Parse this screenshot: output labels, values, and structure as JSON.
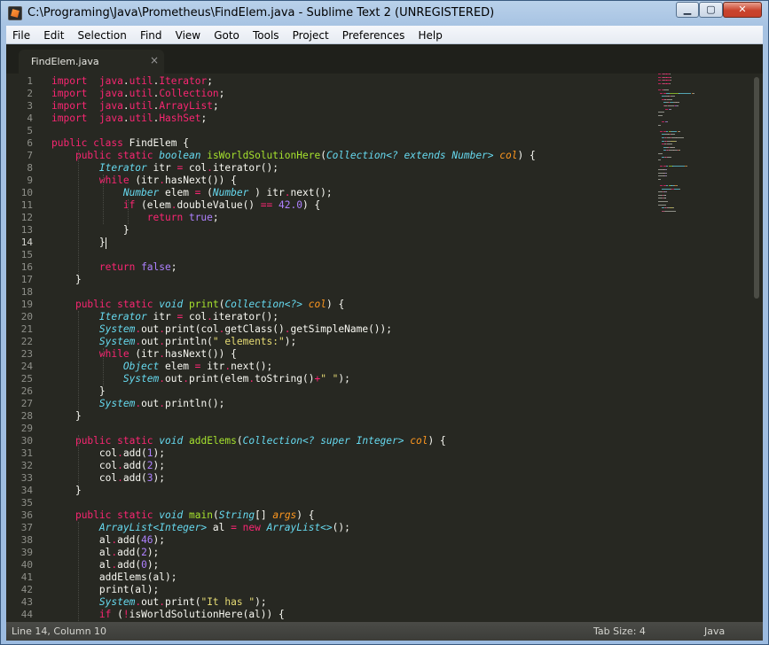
{
  "window": {
    "title": "C:\\Programing\\Java\\Prometheus\\FindElem.java - Sublime Text 2 (UNREGISTERED)",
    "buttons": {
      "minimize": "▁",
      "maximize": "▢",
      "close": "✕"
    }
  },
  "menu": [
    "File",
    "Edit",
    "Selection",
    "Find",
    "View",
    "Goto",
    "Tools",
    "Project",
    "Preferences",
    "Help"
  ],
  "tab": {
    "label": "FindElem.java",
    "close": "×"
  },
  "code": {
    "line_numbers": [
      "1",
      "2",
      "3",
      "4",
      "5",
      "6",
      "7",
      "8",
      "9",
      "10",
      "11",
      "12",
      "13",
      "14",
      "15",
      "16",
      "17",
      "18",
      "19",
      "20",
      "21",
      "22",
      "23",
      "24",
      "25",
      "26",
      "27",
      "28",
      "29",
      "30",
      "31",
      "32",
      "33",
      "34",
      "35",
      "36",
      "37",
      "38",
      "39",
      "40",
      "41",
      "42",
      "43",
      "44"
    ],
    "lines": [
      [
        [
          "k",
          "import"
        ],
        [
          "",
          "  "
        ],
        [
          "t2",
          "java"
        ],
        [
          "",
          "."
        ],
        [
          "t2",
          "util"
        ],
        [
          "",
          "."
        ],
        [
          "t2",
          "Iterator"
        ],
        [
          "",
          ";"
        ]
      ],
      [
        [
          "k",
          "import"
        ],
        [
          "",
          "  "
        ],
        [
          "t2",
          "java"
        ],
        [
          "",
          "."
        ],
        [
          "t2",
          "util"
        ],
        [
          "",
          "."
        ],
        [
          "t2",
          "Collection"
        ],
        [
          "",
          ";"
        ]
      ],
      [
        [
          "k",
          "import"
        ],
        [
          "",
          "  "
        ],
        [
          "t2",
          "java"
        ],
        [
          "",
          "."
        ],
        [
          "t2",
          "util"
        ],
        [
          "",
          "."
        ],
        [
          "t2",
          "ArrayList"
        ],
        [
          "",
          ";"
        ]
      ],
      [
        [
          "k",
          "import"
        ],
        [
          "",
          "  "
        ],
        [
          "t2",
          "java"
        ],
        [
          "",
          "."
        ],
        [
          "t2",
          "util"
        ],
        [
          "",
          "."
        ],
        [
          "t2",
          "HashSet"
        ],
        [
          "",
          ";"
        ]
      ],
      [],
      [
        [
          "k",
          "public"
        ],
        [
          "",
          " "
        ],
        [
          "k",
          "class"
        ],
        [
          "",
          " FindElem {"
        ]
      ],
      [
        [
          "",
          "    "
        ],
        [
          "k",
          "public"
        ],
        [
          "",
          " "
        ],
        [
          "k",
          "static"
        ],
        [
          "",
          " "
        ],
        [
          "t",
          "boolean"
        ],
        [
          "",
          " "
        ],
        [
          "f",
          "isWorldSolutionHere"
        ],
        [
          "",
          "("
        ],
        [
          "t",
          "Collection<? extends Number>"
        ],
        [
          "",
          " "
        ],
        [
          "p",
          "col"
        ],
        [
          "",
          ") {"
        ]
      ],
      [
        [
          "",
          "        "
        ],
        [
          "t",
          "Iterator"
        ],
        [
          "",
          " itr "
        ],
        [
          "k",
          "="
        ],
        [
          "",
          " col"
        ],
        [
          "k",
          "."
        ],
        [
          "",
          "iterator();"
        ]
      ],
      [
        [
          "",
          "        "
        ],
        [
          "k",
          "while"
        ],
        [
          "",
          " (itr"
        ],
        [
          "k",
          "."
        ],
        [
          "",
          "hasNext()) {"
        ]
      ],
      [
        [
          "",
          "            "
        ],
        [
          "t",
          "Number"
        ],
        [
          "",
          " elem "
        ],
        [
          "k",
          "="
        ],
        [
          "",
          " ("
        ],
        [
          "t",
          "Number"
        ],
        [
          "",
          " ) itr"
        ],
        [
          "k",
          "."
        ],
        [
          "",
          "next();"
        ]
      ],
      [
        [
          "",
          "            "
        ],
        [
          "k",
          "if"
        ],
        [
          "",
          " (elem"
        ],
        [
          "k",
          "."
        ],
        [
          "",
          "doubleValue() "
        ],
        [
          "k",
          "=="
        ],
        [
          "",
          " "
        ],
        [
          "n",
          "42.0"
        ],
        [
          "",
          ") {"
        ]
      ],
      [
        [
          "",
          "                "
        ],
        [
          "k",
          "return"
        ],
        [
          "",
          " "
        ],
        [
          "n",
          "true"
        ],
        [
          "",
          ";"
        ]
      ],
      [
        [
          "",
          "            }"
        ]
      ],
      [
        [
          "",
          "        }"
        ],
        [
          "cur",
          ""
        ]
      ],
      [],
      [
        [
          "",
          "        "
        ],
        [
          "k",
          "return"
        ],
        [
          "",
          " "
        ],
        [
          "n",
          "false"
        ],
        [
          "",
          ";"
        ]
      ],
      [
        [
          "",
          "    }"
        ]
      ],
      [],
      [
        [
          "",
          "    "
        ],
        [
          "k",
          "public"
        ],
        [
          "",
          " "
        ],
        [
          "k",
          "static"
        ],
        [
          "",
          " "
        ],
        [
          "t",
          "void"
        ],
        [
          "",
          " "
        ],
        [
          "f",
          "print"
        ],
        [
          "",
          "("
        ],
        [
          "t",
          "Collection<?>"
        ],
        [
          "",
          " "
        ],
        [
          "p",
          "col"
        ],
        [
          "",
          ") {"
        ]
      ],
      [
        [
          "",
          "        "
        ],
        [
          "t",
          "Iterator"
        ],
        [
          "",
          " itr "
        ],
        [
          "k",
          "="
        ],
        [
          "",
          " col"
        ],
        [
          "k",
          "."
        ],
        [
          "",
          "iterator();"
        ]
      ],
      [
        [
          "",
          "        "
        ],
        [
          "t",
          "System"
        ],
        [
          "k",
          "."
        ],
        [
          "",
          "out"
        ],
        [
          "k",
          "."
        ],
        [
          "",
          "print(col"
        ],
        [
          "k",
          "."
        ],
        [
          "",
          "getClass()"
        ],
        [
          "k",
          "."
        ],
        [
          "",
          "getSimpleName());"
        ]
      ],
      [
        [
          "",
          "        "
        ],
        [
          "t",
          "System"
        ],
        [
          "k",
          "."
        ],
        [
          "",
          "out"
        ],
        [
          "k",
          "."
        ],
        [
          "",
          "println("
        ],
        [
          "s",
          "\" elements:\""
        ],
        [
          "",
          ");"
        ]
      ],
      [
        [
          "",
          "        "
        ],
        [
          "k",
          "while"
        ],
        [
          "",
          " (itr"
        ],
        [
          "k",
          "."
        ],
        [
          "",
          "hasNext()) {"
        ]
      ],
      [
        [
          "",
          "            "
        ],
        [
          "t",
          "Object"
        ],
        [
          "",
          " elem "
        ],
        [
          "k",
          "="
        ],
        [
          "",
          " itr"
        ],
        [
          "k",
          "."
        ],
        [
          "",
          "next();"
        ]
      ],
      [
        [
          "",
          "            "
        ],
        [
          "t",
          "System"
        ],
        [
          "k",
          "."
        ],
        [
          "",
          "out"
        ],
        [
          "k",
          "."
        ],
        [
          "",
          "print(elem"
        ],
        [
          "k",
          "."
        ],
        [
          "",
          "toString()"
        ],
        [
          "k",
          "+"
        ],
        [
          "s",
          "\" \""
        ],
        [
          "",
          ");"
        ]
      ],
      [
        [
          "",
          "        }"
        ]
      ],
      [
        [
          "",
          "        "
        ],
        [
          "t",
          "System"
        ],
        [
          "k",
          "."
        ],
        [
          "",
          "out"
        ],
        [
          "k",
          "."
        ],
        [
          "",
          "println();"
        ]
      ],
      [
        [
          "",
          "    }"
        ]
      ],
      [],
      [
        [
          "",
          "    "
        ],
        [
          "k",
          "public"
        ],
        [
          "",
          " "
        ],
        [
          "k",
          "static"
        ],
        [
          "",
          " "
        ],
        [
          "t",
          "void"
        ],
        [
          "",
          " "
        ],
        [
          "f",
          "addElems"
        ],
        [
          "",
          "("
        ],
        [
          "t",
          "Collection<? super Integer>"
        ],
        [
          "",
          " "
        ],
        [
          "p",
          "col"
        ],
        [
          "",
          ") {"
        ]
      ],
      [
        [
          "",
          "        col"
        ],
        [
          "k",
          "."
        ],
        [
          "",
          "add("
        ],
        [
          "n",
          "1"
        ],
        [
          "",
          ");"
        ]
      ],
      [
        [
          "",
          "        col"
        ],
        [
          "k",
          "."
        ],
        [
          "",
          "add("
        ],
        [
          "n",
          "2"
        ],
        [
          "",
          ");"
        ]
      ],
      [
        [
          "",
          "        col"
        ],
        [
          "k",
          "."
        ],
        [
          "",
          "add("
        ],
        [
          "n",
          "3"
        ],
        [
          "",
          ");"
        ]
      ],
      [
        [
          "",
          "    }"
        ]
      ],
      [],
      [
        [
          "",
          "    "
        ],
        [
          "k",
          "public"
        ],
        [
          "",
          " "
        ],
        [
          "k",
          "static"
        ],
        [
          "",
          " "
        ],
        [
          "t",
          "void"
        ],
        [
          "",
          " "
        ],
        [
          "f",
          "main"
        ],
        [
          "",
          "("
        ],
        [
          "t",
          "String"
        ],
        [
          "",
          "[] "
        ],
        [
          "p",
          "args"
        ],
        [
          "",
          ") {"
        ]
      ],
      [
        [
          "",
          "        "
        ],
        [
          "t",
          "ArrayList<Integer>"
        ],
        [
          "",
          " al "
        ],
        [
          "k",
          "="
        ],
        [
          "",
          " "
        ],
        [
          "k",
          "new"
        ],
        [
          "",
          " "
        ],
        [
          "t",
          "ArrayList<>"
        ],
        [
          "",
          "();"
        ]
      ],
      [
        [
          "",
          "        al"
        ],
        [
          "k",
          "."
        ],
        [
          "",
          "add("
        ],
        [
          "n",
          "46"
        ],
        [
          "",
          ");"
        ]
      ],
      [
        [
          "",
          "        al"
        ],
        [
          "k",
          "."
        ],
        [
          "",
          "add("
        ],
        [
          "n",
          "2"
        ],
        [
          "",
          ");"
        ]
      ],
      [
        [
          "",
          "        al"
        ],
        [
          "k",
          "."
        ],
        [
          "",
          "add("
        ],
        [
          "n",
          "0"
        ],
        [
          "",
          ");"
        ]
      ],
      [
        [
          "",
          "        addElems(al);"
        ]
      ],
      [
        [
          "",
          "        print(al);"
        ]
      ],
      [
        [
          "",
          "        "
        ],
        [
          "t",
          "System"
        ],
        [
          "k",
          "."
        ],
        [
          "",
          "out"
        ],
        [
          "k",
          "."
        ],
        [
          "",
          "print("
        ],
        [
          "s",
          "\"It has \""
        ],
        [
          "",
          ");"
        ]
      ],
      [
        [
          "",
          "        "
        ],
        [
          "k",
          "if"
        ],
        [
          "",
          " ("
        ],
        [
          "k",
          "!"
        ],
        [
          "",
          "isWorldSolutionHere(al)) {"
        ]
      ]
    ]
  },
  "status": {
    "position": "Line 14, Column 10",
    "tab_size": "Tab Size: 4",
    "syntax": "Java"
  },
  "colors": {
    "background": "#272822",
    "keyword": "#f92672",
    "type": "#66d9ef",
    "function": "#a6e22e",
    "number": "#ae81ff",
    "string": "#e6db74",
    "param": "#fd971f"
  }
}
